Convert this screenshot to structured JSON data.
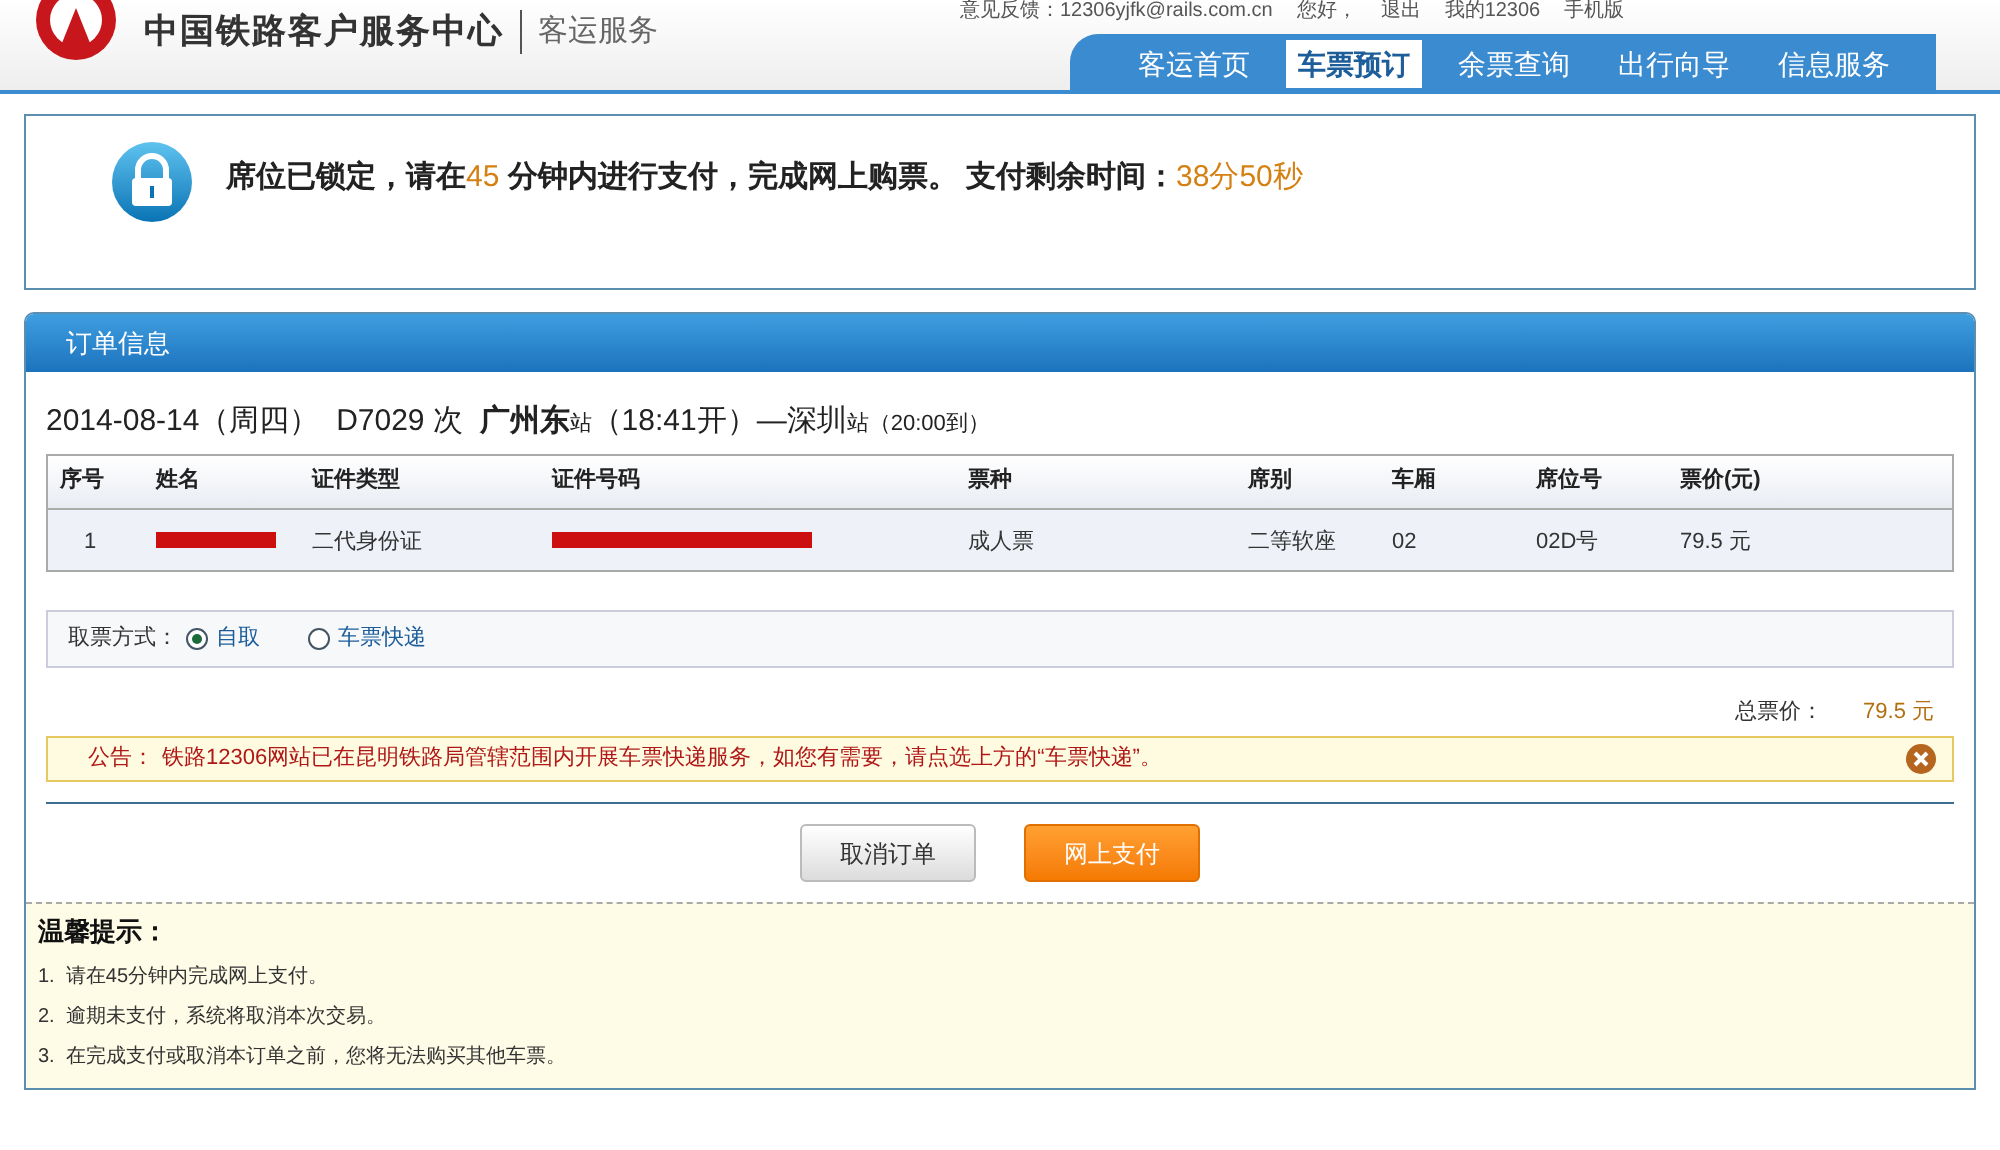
{
  "header": {
    "site_title": "中国铁路客户服务中心",
    "section": "客运服务",
    "top_links": [
      "意见反馈：12306yjfk@rails.com.cn",
      "您好，",
      "退出",
      "我的12306",
      "手机版"
    ],
    "nav": [
      {
        "label": "客运首页",
        "selected": false
      },
      {
        "label": "车票预订",
        "selected": true
      },
      {
        "label": "余票查询",
        "selected": false
      },
      {
        "label": "出行向导",
        "selected": false
      },
      {
        "label": "信息服务",
        "selected": false
      }
    ]
  },
  "notice": {
    "parts": [
      "席位已锁定，请在",
      "45",
      "分钟内进行支付，完成网上购票。 支付剩余时间：",
      "38分50秒"
    ]
  },
  "order": {
    "title": "订单信息",
    "trip": [
      "2014-08-14（周四）",
      "D7029 次",
      "广州东",
      "站",
      "（18:41开）—深圳",
      "站",
      "（20:00到）"
    ],
    "columns": [
      "序号",
      "姓名",
      "证件类型",
      "证件号码",
      "票种",
      "席别",
      "车厢",
      "席位号",
      "票价(元)"
    ],
    "rows": [
      {
        "cells": [
          {
            "kind": "text",
            "text": "1"
          },
          {
            "kind": "redacted"
          },
          {
            "kind": "text",
            "text": "二代身份证"
          },
          {
            "kind": "redacted"
          },
          {
            "kind": "text",
            "text": "成人票"
          },
          {
            "kind": "text",
            "text": "二等软座"
          },
          {
            "kind": "text",
            "text": "02"
          },
          {
            "kind": "text",
            "text": "02D号"
          },
          {
            "kind": "text",
            "text": "79.5 元"
          }
        ]
      }
    ],
    "pickup": {
      "label": "取票方式：",
      "options": [
        {
          "label": "自取",
          "selected": true
        },
        {
          "label": "车票快递",
          "selected": false
        }
      ]
    },
    "total": {
      "label": "总票价：",
      "value": "79.5 元"
    },
    "announcement": {
      "label": "公告：",
      "text": "铁路12306网站已在昆明铁路局管辖范围内开展车票快递服务，如您有需要，请点选上方的“车票快递”。"
    },
    "buttons": [
      {
        "kind": "secondary",
        "label": "取消订单"
      },
      {
        "kind": "primary",
        "label": "网上支付"
      }
    ],
    "tips": {
      "title": "温馨提示：",
      "items": [
        "1.  请在45分钟内完成网上支付。",
        "2.  逾期未支付，系统将取消本次交易。",
        "3.  在完成支付或取消本订单之前，您将无法购买其他车票。"
      ]
    }
  }
}
